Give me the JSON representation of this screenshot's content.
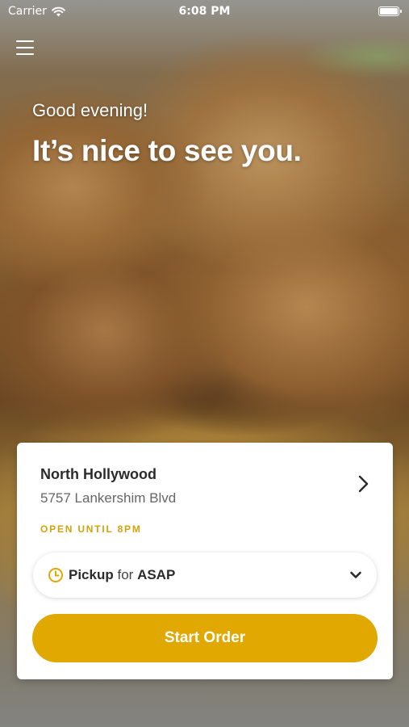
{
  "status_bar": {
    "carrier": "Carrier",
    "time": "6:08 PM",
    "icons": [
      "wifi-icon",
      "battery-icon"
    ]
  },
  "header": {
    "menu_icon": "menu-icon",
    "greeting": "Good evening!",
    "headline": "It’s nice to see you."
  },
  "location_card": {
    "name": "North Hollywood",
    "address": "5757 Lankershim Blvd",
    "hours": "OPEN UNTIL 8PM",
    "chevron_icon": "chevron-right-icon"
  },
  "order_mode": {
    "mode": "Pickup",
    "connector": "for",
    "time": "ASAP",
    "icon": "clock-icon",
    "dropdown_icon": "chevron-down-icon"
  },
  "actions": {
    "start_order_label": "Start Order"
  },
  "colors": {
    "accent": "#e0a800",
    "hours_text": "#d4a20a",
    "card_bg": "#ffffff",
    "title_text": "#2b2b2b",
    "secondary_text": "#666666"
  }
}
